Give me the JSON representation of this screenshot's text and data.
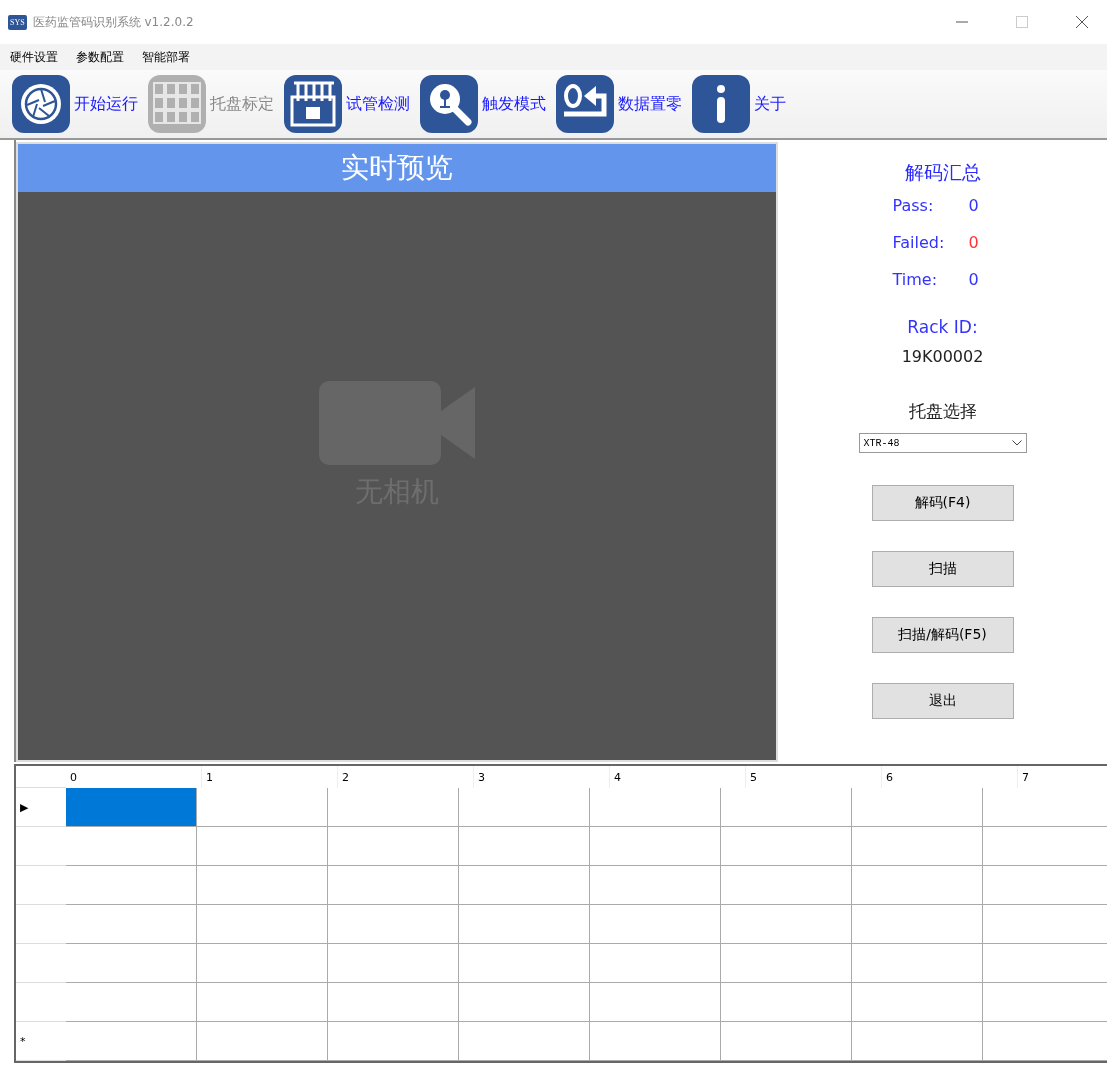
{
  "window": {
    "logo": "SYS",
    "title": "医药监管码识别系统 v1.2.0.2"
  },
  "menu": [
    "硬件设置",
    "参数配置",
    "智能部署"
  ],
  "toolbar": [
    {
      "kind": "aperture",
      "label": "开始运行",
      "disabled": false
    },
    {
      "kind": "grid",
      "label": "托盘标定",
      "disabled": true
    },
    {
      "kind": "tubes",
      "label": "试管检测",
      "disabled": false
    },
    {
      "kind": "magnifier",
      "label": "触发模式",
      "disabled": false
    },
    {
      "kind": "reset",
      "label": "数据置零",
      "disabled": false
    },
    {
      "kind": "info",
      "label": "关于",
      "disabled": false
    }
  ],
  "preview": {
    "title": "实时预览",
    "status": "无相机"
  },
  "summary": {
    "title": "解码汇总",
    "stats": [
      {
        "label": "Pass:",
        "value": "0",
        "color": "#3333ff"
      },
      {
        "label": "Failed:",
        "value": "0",
        "color": "#ff3333"
      },
      {
        "label": "Time:",
        "value": "0",
        "color": "#3333ff"
      }
    ],
    "rack_label": "Rack ID:",
    "rack_id": "19K00002",
    "tray_label": "托盘选择",
    "tray_value": "XTR-48"
  },
  "buttons": [
    "解码(F4)",
    "扫描",
    "扫描/解码(F5)",
    "退出"
  ],
  "table": {
    "columns": [
      "0",
      "1",
      "2",
      "3",
      "4",
      "5",
      "6",
      "7"
    ],
    "rows": [
      {
        "marker": "▶",
        "cells": [
          {
            "selected": true
          },
          {
            "selected": false
          },
          {
            "selected": false
          },
          {
            "selected": false
          },
          {
            "selected": false
          },
          {
            "selected": false
          },
          {
            "selected": false
          },
          {
            "selected": false
          }
        ]
      },
      {
        "cells": [
          {
            "selected": false
          },
          {
            "selected": false
          },
          {
            "selected": false
          },
          {
            "selected": false
          },
          {
            "selected": false
          },
          {
            "selected": false
          },
          {
            "selected": false
          },
          {
            "selected": false
          }
        ]
      },
      {
        "cells": [
          {
            "selected": false
          },
          {
            "selected": false
          },
          {
            "selected": false
          },
          {
            "selected": false
          },
          {
            "selected": false
          },
          {
            "selected": false
          },
          {
            "selected": false
          },
          {
            "selected": false
          }
        ]
      },
      {
        "cells": [
          {
            "selected": false
          },
          {
            "selected": false
          },
          {
            "selected": false
          },
          {
            "selected": false
          },
          {
            "selected": false
          },
          {
            "selected": false
          },
          {
            "selected": false
          },
          {
            "selected": false
          }
        ]
      },
      {
        "cells": [
          {
            "selected": false
          },
          {
            "selected": false
          },
          {
            "selected": false
          },
          {
            "selected": false
          },
          {
            "selected": false
          },
          {
            "selected": false
          },
          {
            "selected": false
          },
          {
            "selected": false
          }
        ]
      },
      {
        "cells": [
          {
            "selected": false
          },
          {
            "selected": false
          },
          {
            "selected": false
          },
          {
            "selected": false
          },
          {
            "selected": false
          },
          {
            "selected": false
          },
          {
            "selected": false
          },
          {
            "selected": false
          }
        ]
      },
      {
        "marker": "*",
        "cells": [
          {
            "selected": false
          },
          {
            "selected": false
          },
          {
            "selected": false
          },
          {
            "selected": false
          },
          {
            "selected": false
          },
          {
            "selected": false
          },
          {
            "selected": false
          },
          {
            "selected": false
          }
        ]
      }
    ]
  }
}
